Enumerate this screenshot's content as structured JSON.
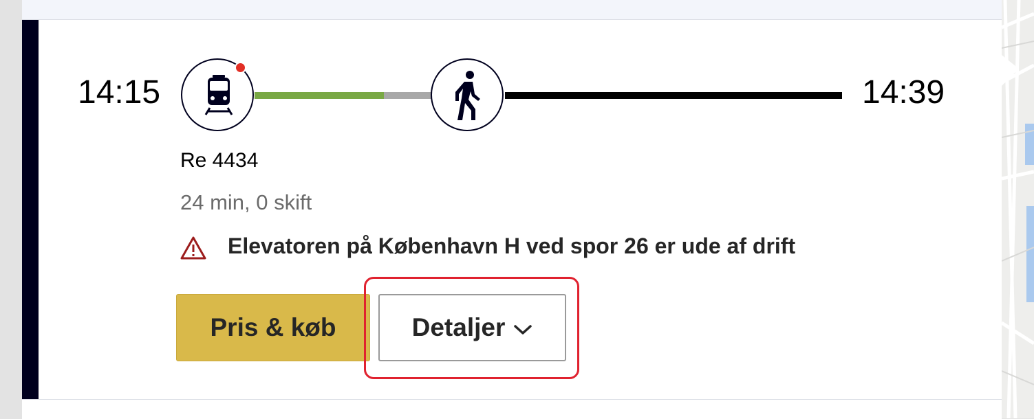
{
  "journey": {
    "departure_time": "14:15",
    "arrival_time": "14:39",
    "line_name": "Re 4434",
    "duration_text": "24 min, 0 skift",
    "warning_text": "Elevatoren på København H ved spor 26 er ude af drift"
  },
  "legs": [
    {
      "icon": "train-icon",
      "color": "#79a844",
      "has_alert": true
    },
    {
      "icon": "walk-icon",
      "color": "#000000"
    }
  ],
  "buttons": {
    "buy_label": "Pris & køb",
    "details_label": "Detaljer"
  },
  "colors": {
    "accent_dark": "#00001e",
    "buy_button": "#d9b94a",
    "alert": "#e22f25",
    "highlight": "#e0222f"
  }
}
